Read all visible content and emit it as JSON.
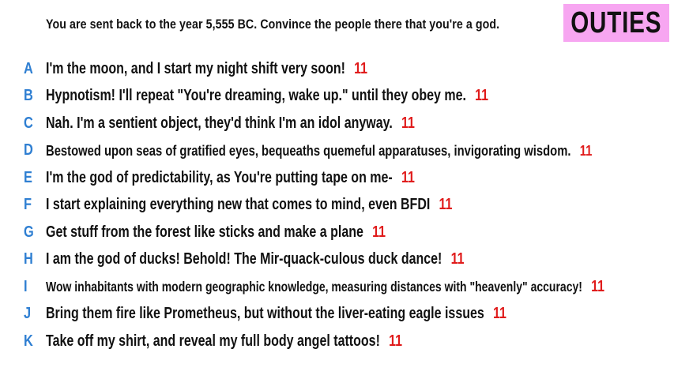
{
  "prompt": "You are sent back to the year 5,555 BC. Convince the people there that you're a god.",
  "team": "OUTIES",
  "answers": [
    {
      "letter": "A",
      "text": "I'm the moon, and I start my night shift very soon!",
      "score": "11"
    },
    {
      "letter": "B",
      "text": "Hypnotism! I'll repeat \"You're dreaming, wake up.\" until they obey me.",
      "score": "11"
    },
    {
      "letter": "C",
      "text": "Nah. I'm a sentient object, they'd think I'm an idol anyway.",
      "score": "11"
    },
    {
      "letter": "D",
      "text": "Bestowed upon seas of gratified eyes, bequeaths quemeful apparatuses, invigorating wisdom.",
      "score": "11"
    },
    {
      "letter": "E",
      "text": "I'm the god of predictability, as You're putting tape on me-",
      "score": "11"
    },
    {
      "letter": "F",
      "text": "I start explaining everything new that comes to mind, even BFDI",
      "score": "11"
    },
    {
      "letter": "G",
      "text": "Get stuff from the forest like sticks and make a plane",
      "score": "11"
    },
    {
      "letter": "H",
      "text": "I am the god of ducks! Behold! The Mir-quack-culous duck dance!",
      "score": "11"
    },
    {
      "letter": "I",
      "text": "Wow inhabitants with modern geographic knowledge, measuring distances with \"heavenly\" accuracy!",
      "score": "11"
    },
    {
      "letter": "J",
      "text": "Bring them fire like Prometheus, but without the liver-eating eagle issues",
      "score": "11"
    },
    {
      "letter": "K",
      "text": "Take off my shirt, and reveal my full body angel tattoos!",
      "score": "11"
    }
  ],
  "colors": {
    "letter": "#2f7fd2",
    "score": "#e01b1b",
    "badge": "#f7a6f1"
  }
}
